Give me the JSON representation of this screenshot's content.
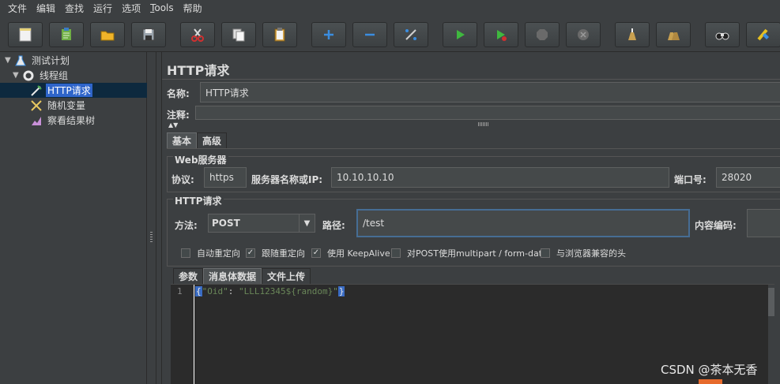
{
  "menu": {
    "items": [
      "文件",
      "编辑",
      "查找",
      "运行",
      "选项",
      "Tools",
      "帮助"
    ]
  },
  "toolbar": {
    "buttons": [
      "new-icon",
      "templates-icon",
      "open-icon",
      "save-icon",
      "cut-icon",
      "copy-icon",
      "paste-icon",
      "expand-icon",
      "collapse-icon",
      "toggle-icon",
      "start-icon",
      "start-no-pause-icon",
      "stop-icon",
      "shutdown-icon",
      "clear-icon",
      "clear-all-icon",
      "search-icon",
      "reset-search-icon"
    ]
  },
  "tree": {
    "items": [
      {
        "label": "测试计划",
        "icon": "test-plan-icon",
        "level": 0,
        "expanded": true
      },
      {
        "label": "线程组",
        "icon": "thread-group-icon",
        "level": 1,
        "expanded": true
      },
      {
        "label": "HTTP请求",
        "icon": "sampler-icon",
        "level": 2,
        "selected": true
      },
      {
        "label": "随机变量",
        "icon": "random-variable-icon",
        "level": 2
      },
      {
        "label": "察看结果树",
        "icon": "view-results-tree-icon",
        "level": 2
      }
    ]
  },
  "panel": {
    "title": "HTTP请求",
    "name_label": "名称:",
    "name_value": "HTTP请求",
    "comment_label": "注释:",
    "tabs": [
      "基本",
      "高级"
    ],
    "web_server": {
      "group_title": "Web服务器",
      "protocol_label": "协议:",
      "protocol_value": "https",
      "server_label": "服务器名称或IP:",
      "server_value": "10.10.10.10",
      "port_label": "端口号:",
      "port_value": "28020"
    },
    "http_request": {
      "group_title": "HTTP请求",
      "method_label": "方法:",
      "method_value": "POST",
      "path_label": "路径:",
      "path_value": "/test",
      "encoding_label": "内容编码:"
    },
    "checkboxes": [
      {
        "label": "自动重定向",
        "checked": false
      },
      {
        "label": "跟随重定向",
        "checked": true
      },
      {
        "label": "使用 KeepAlive",
        "checked": true
      },
      {
        "label": "对POST使用multipart / form-data",
        "checked": false
      },
      {
        "label": "与浏览器兼容的头",
        "checked": false
      }
    ],
    "body_tabs": [
      "参数",
      "消息体数据",
      "文件上传"
    ],
    "editor": {
      "line_number": "1",
      "open_brace": "{",
      "key": "\"Oid\"",
      "colon": ": ",
      "value": "\"LLL12345${random}\"",
      "close_brace": "}"
    }
  },
  "watermark": "CSDN @茶本无香",
  "colors": {
    "background": "#3c3f41",
    "selection": "#2f65ca",
    "editor_bg": "#2b2b2b",
    "string_green": "#6a8759",
    "brace_highlight": "#3a6cc4"
  }
}
